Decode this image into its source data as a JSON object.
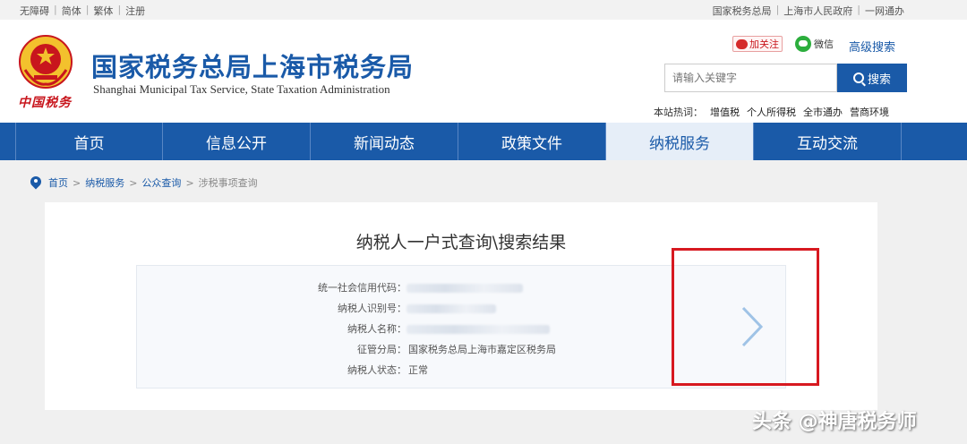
{
  "topbar": {
    "left": [
      "无障碍",
      "简体",
      "繁体",
      "注册"
    ],
    "right": [
      "国家税务总局",
      "上海市人民政府",
      "一网通办"
    ]
  },
  "header": {
    "logo_text": "中国税务",
    "title": "国家税务总局上海市税务局",
    "subtitle": "Shanghai Municipal Tax Service, State Taxation Administration",
    "follow_label": "加关注",
    "wechat_label": "微信",
    "advanced_search": "高级搜索",
    "search_placeholder": "请输入关键字",
    "search_button": "搜索",
    "hot_label": "本站热词：",
    "hot_words": [
      "增值税",
      "个人所得税",
      "全市通办",
      "营商环境"
    ]
  },
  "nav": {
    "tabs": [
      "首页",
      "信息公开",
      "新闻动态",
      "政策文件",
      "纳税服务",
      "互动交流"
    ],
    "active_index": 4
  },
  "breadcrumb": {
    "items": [
      "首页",
      "纳税服务",
      "公众查询"
    ],
    "current": "涉税事项查询"
  },
  "result": {
    "title": "纳税人一户式查询\\搜索结果",
    "fields": [
      {
        "label": "统一社会信用代码",
        "value": ""
      },
      {
        "label": "纳税人识别号",
        "value": ""
      },
      {
        "label": "纳税人名称",
        "value": ""
      },
      {
        "label": "征管分局",
        "value": "国家税务总局上海市嘉定区税务局"
      },
      {
        "label": "纳税人状态",
        "value": "正常"
      }
    ]
  },
  "watermark": "头条 @神唐税务师",
  "colors": {
    "brand_blue": "#1a5aa8",
    "highlight_red": "#d71920",
    "logo_red": "#c8161d"
  }
}
